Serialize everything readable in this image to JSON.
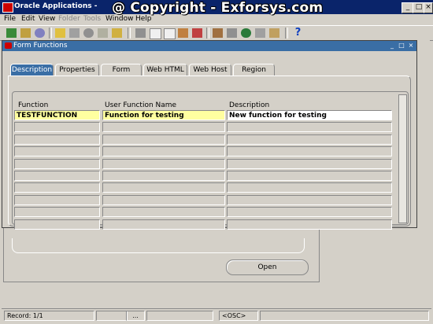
{
  "app": {
    "title": "Oracle Applications -",
    "watermark": "@ Copyright - Exforsys.com",
    "window_buttons": [
      "_",
      "□",
      "×"
    ]
  },
  "menu": [
    "File",
    "Edit",
    "View",
    "Folder",
    "Tools",
    "Window",
    "Help"
  ],
  "menu_disabled": [
    "Folder",
    "Tools"
  ],
  "toolbar_icons": [
    "new-icon",
    "open-icon",
    "save-icon",
    "folder-icon",
    "print-icon",
    "find-icon",
    "attach-icon",
    "cut-icon",
    "copy-icon",
    "paste-icon",
    "new-record-icon",
    "delete-record-icon",
    "edit-icon",
    "zoom-icon",
    "translations-icon",
    "attachments-icon",
    "folder-tools-icon",
    "help-icon"
  ],
  "form": {
    "title": "Form Functions",
    "window_buttons": [
      "_",
      "□",
      "×"
    ],
    "tabs": [
      "Description",
      "Properties",
      "Form",
      "Web HTML",
      "Web Host",
      "Region"
    ],
    "active_tab": "Description",
    "columns": [
      "Function",
      "User Function Name",
      "Description"
    ],
    "rows": [
      [
        "TESTFUNCTION",
        "Function for testing",
        "New function for testing"
      ],
      [
        "",
        "",
        ""
      ],
      [
        "",
        "",
        ""
      ],
      [
        "",
        "",
        ""
      ],
      [
        "",
        "",
        ""
      ],
      [
        "",
        "",
        ""
      ],
      [
        "",
        "",
        ""
      ],
      [
        "",
        "",
        ""
      ],
      [
        "",
        "",
        ""
      ],
      [
        "",
        "",
        ""
      ]
    ]
  },
  "background_window": {
    "open_button": "Open"
  },
  "status": {
    "record": "Record: 1/1",
    "dots": "...",
    "osc": "<OSC>"
  }
}
